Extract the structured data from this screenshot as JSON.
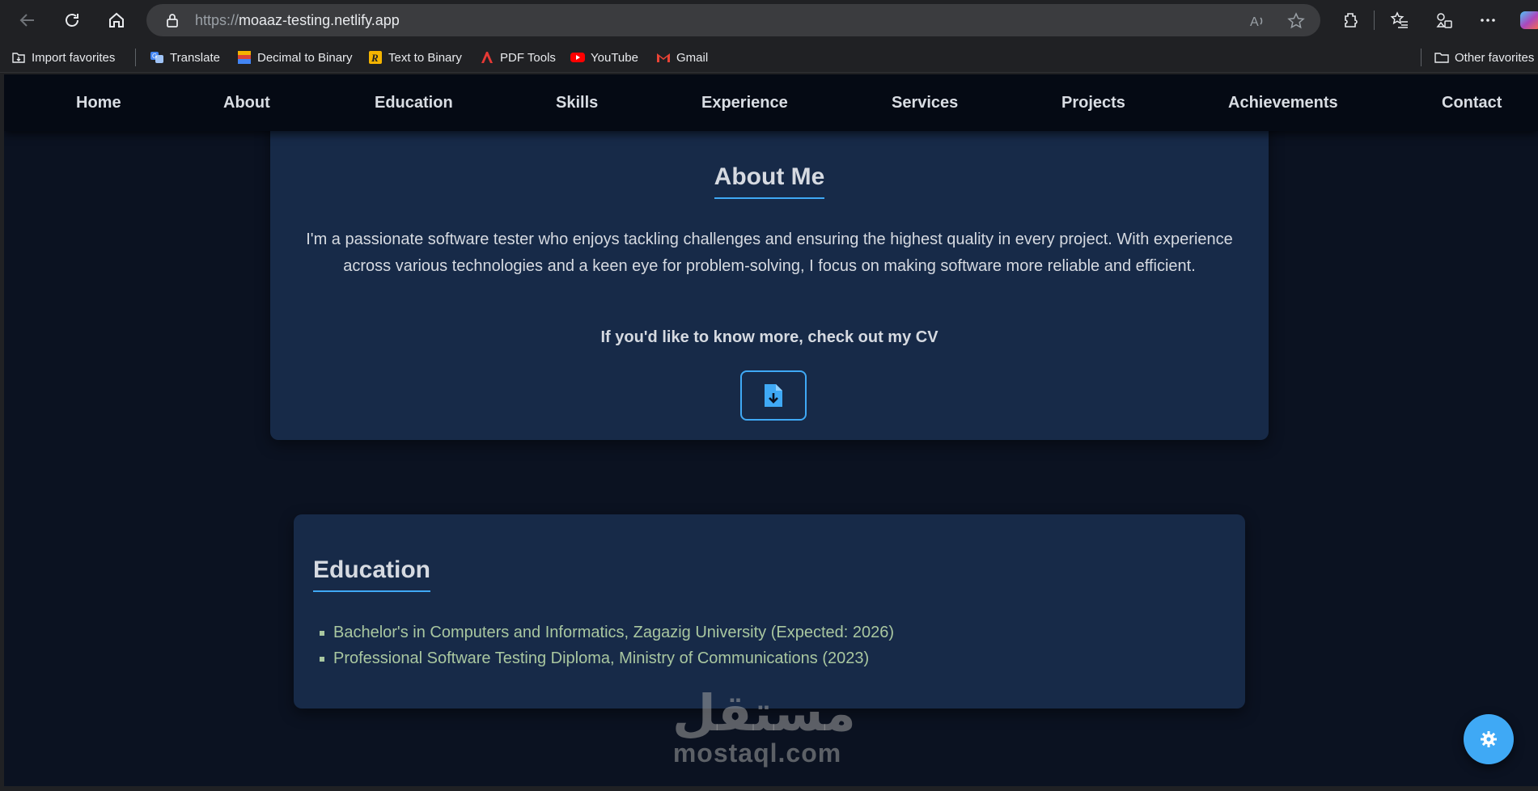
{
  "browser": {
    "url_scheme": "https://",
    "url_host": "moaaz-testing.netlify.app",
    "read_aloud_label": "A"
  },
  "bookmarks": {
    "items": [
      {
        "label": "Import favorites",
        "icon": "import-icon"
      },
      {
        "label": "Translate",
        "icon": "translate-icon"
      },
      {
        "label": "Decimal to Binary",
        "icon": "decimal-icon"
      },
      {
        "label": "Text to Binary",
        "icon": "text-binary-icon"
      },
      {
        "label": "PDF Tools",
        "icon": "pdf-icon"
      },
      {
        "label": "YouTube",
        "icon": "youtube-icon"
      },
      {
        "label": "Gmail",
        "icon": "gmail-icon"
      }
    ],
    "other": "Other favorites"
  },
  "site_nav": {
    "items": [
      "Home",
      "About",
      "Education",
      "Skills",
      "Experience",
      "Services",
      "Projects",
      "Achievements",
      "Contact"
    ]
  },
  "about": {
    "title": "About Me",
    "text": "I'm a passionate software tester who enjoys tackling challenges and ensuring the highest quality in every project. With experience across various technologies and a keen eye for problem-solving, I focus on making software more reliable and efficient.",
    "cta": "If you'd like to know more, check out my CV",
    "cv_icon": "file-download-icon"
  },
  "education": {
    "title": "Education",
    "items": [
      "Bachelor's in Computers and Informatics, Zagazig University (Expected: 2026)",
      "Professional Software Testing Diploma, Ministry of Communications (2023)"
    ]
  },
  "watermark": {
    "arabic": "مستقل",
    "latin": "mostaql.com"
  },
  "colors": {
    "accent": "#3fa9f5",
    "page_bg": "#0b1221",
    "card_bg": "#172a48",
    "list_text": "#a9c7a0"
  }
}
